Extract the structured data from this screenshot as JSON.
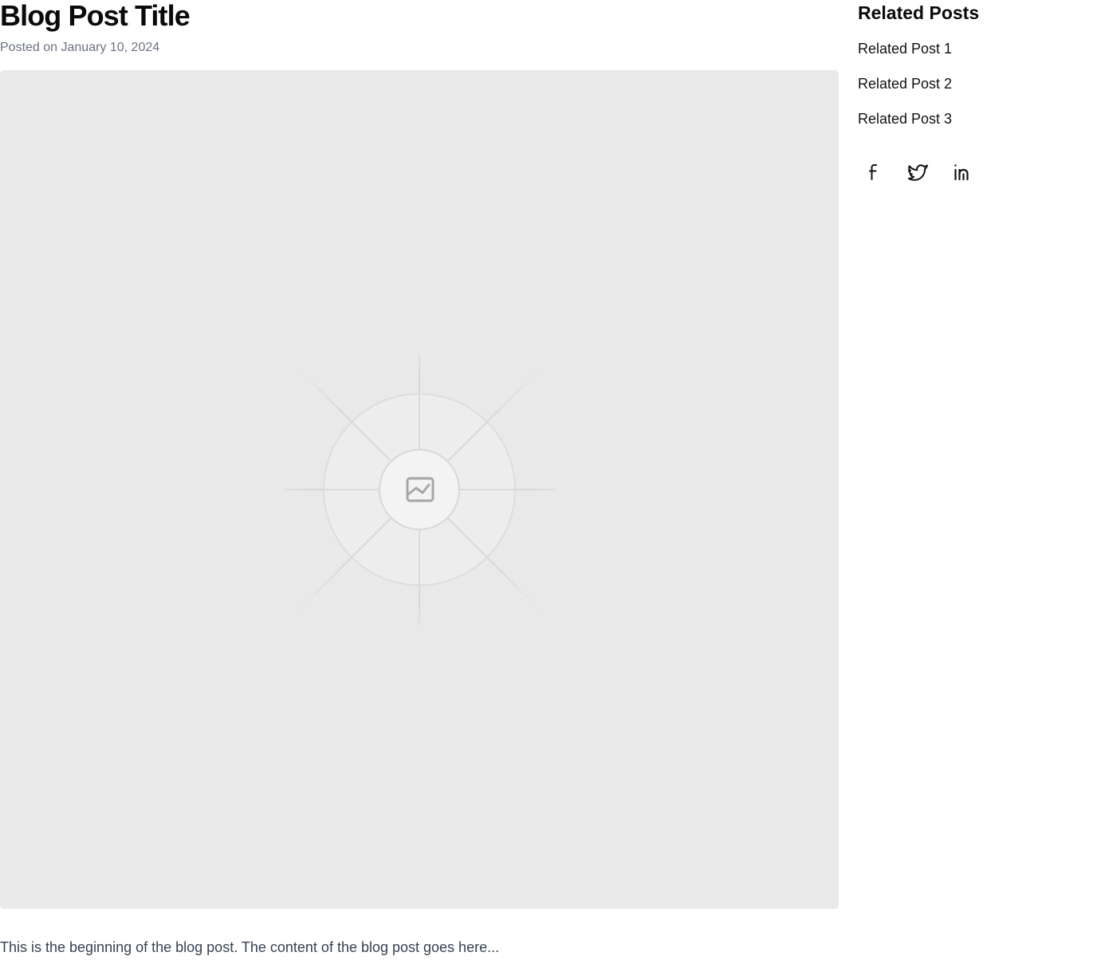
{
  "post": {
    "title": "Blog Post Title",
    "date": "Posted on January 10, 2024",
    "body": "This is the beginning of the blog post. The content of the blog post goes here..."
  },
  "hero_image": {
    "icon": "image-placeholder-icon",
    "background_color": "#e9e9e9"
  },
  "sidebar": {
    "title": "Related Posts",
    "related": [
      {
        "label": "Related Post 1"
      },
      {
        "label": "Related Post 2"
      },
      {
        "label": "Related Post 3"
      }
    ],
    "social": [
      {
        "icon": "facebook-icon"
      },
      {
        "icon": "twitter-icon"
      },
      {
        "icon": "linkedin-icon"
      }
    ]
  }
}
